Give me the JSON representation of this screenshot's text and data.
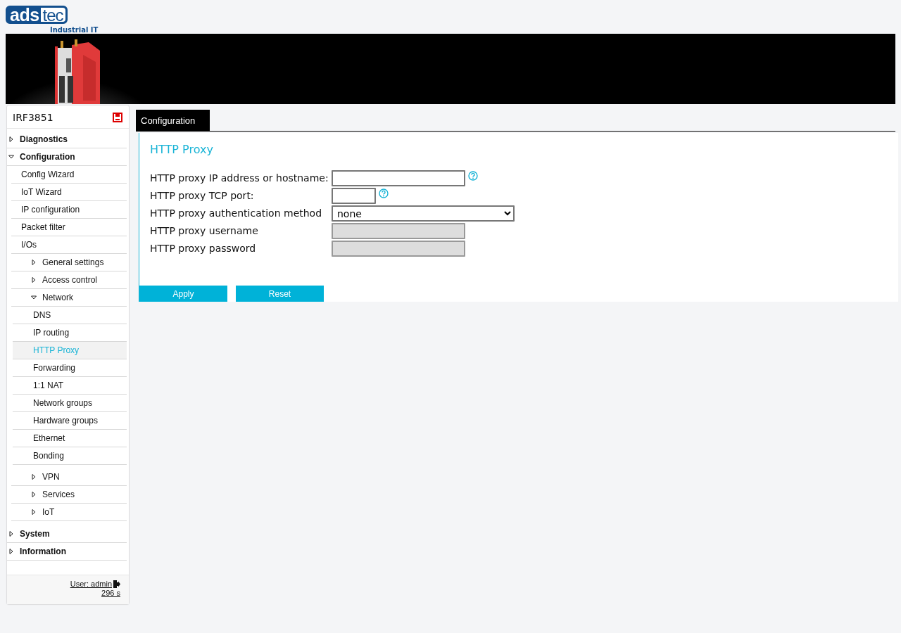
{
  "logo": {
    "part_1": "ads",
    "part_2": "tec",
    "tagline": "Industrial IT"
  },
  "sidebar": {
    "device": "IRF3851",
    "items": [
      {
        "label": "Diagnostics",
        "kind": "folder",
        "expanded": false,
        "selected": false
      },
      {
        "label": "Configuration",
        "kind": "folder",
        "expanded": true,
        "selected": false,
        "children": [
          {
            "label": "Config Wizard",
            "kind": "link",
            "selected": false
          },
          {
            "label": "IoT Wizard",
            "kind": "link",
            "selected": false
          },
          {
            "label": "IP configuration",
            "kind": "link",
            "selected": false
          },
          {
            "label": "Packet filter",
            "kind": "link",
            "selected": false
          },
          {
            "label": "I/Os",
            "kind": "link",
            "selected": false
          },
          {
            "label": "General settings",
            "kind": "folder",
            "expanded": false,
            "selected": false
          },
          {
            "label": "Access control",
            "kind": "folder",
            "expanded": false,
            "selected": false
          },
          {
            "label": "Network",
            "kind": "folder",
            "expanded": true,
            "selected": false,
            "children": [
              {
                "label": "DNS",
                "kind": "link",
                "selected": false
              },
              {
                "label": "IP routing",
                "kind": "link",
                "selected": false
              },
              {
                "label": "HTTP Proxy",
                "kind": "link",
                "selected": true
              },
              {
                "label": "Forwarding",
                "kind": "link",
                "selected": false
              },
              {
                "label": "1:1 NAT",
                "kind": "link",
                "selected": false
              },
              {
                "label": "Network groups",
                "kind": "link",
                "selected": false
              },
              {
                "label": "Hardware groups",
                "kind": "link",
                "selected": false
              },
              {
                "label": "Ethernet",
                "kind": "link",
                "selected": false
              },
              {
                "label": "Bonding",
                "kind": "link",
                "selected": false
              }
            ]
          },
          {
            "label": "VPN",
            "kind": "folder",
            "expanded": false,
            "selected": false
          },
          {
            "label": "Services",
            "kind": "folder",
            "expanded": false,
            "selected": false
          },
          {
            "label": "IoT",
            "kind": "folder",
            "expanded": false,
            "selected": false
          }
        ]
      },
      {
        "label": "System",
        "kind": "folder",
        "expanded": false,
        "selected": false
      },
      {
        "label": "Information",
        "kind": "folder",
        "expanded": false,
        "selected": false
      }
    ],
    "user": "User: admin",
    "timer": "296 s"
  },
  "tabs": [
    {
      "label": "Configuration",
      "selected": true
    }
  ],
  "panel": {
    "title": "HTTP Proxy",
    "fields": [
      {
        "label": "HTTP proxy IP address or hostname:",
        "kind": "text",
        "help": true,
        "disabled": false
      },
      {
        "label": "HTTP proxy TCP port:",
        "kind": "short_text",
        "help": true,
        "disabled": false
      },
      {
        "label": "HTTP proxy authentication method",
        "kind": "select",
        "value": "none",
        "help": false,
        "disabled": false
      },
      {
        "label": "HTTP proxy username",
        "kind": "text",
        "help": false,
        "disabled": true
      },
      {
        "label": "HTTP proxy password",
        "kind": "text",
        "help": false,
        "disabled": true
      }
    ],
    "buttons": [
      "Apply",
      "Reset"
    ]
  }
}
